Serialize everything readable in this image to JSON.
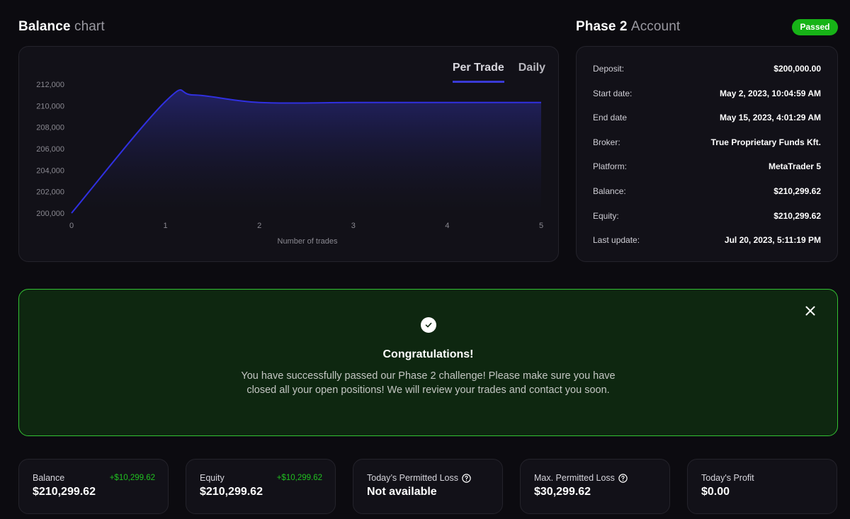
{
  "balance_chart": {
    "title_bold": "Balance",
    "title_muted": "chart",
    "tabs": [
      {
        "label": "Per Trade",
        "active": true
      },
      {
        "label": "Daily",
        "active": false
      }
    ]
  },
  "chart_data": {
    "type": "area",
    "xlabel": "Number of trades",
    "ylabel": "",
    "x_ticks": [
      "0",
      "1",
      "2",
      "3",
      "4",
      "5"
    ],
    "y_ticks": [
      "212,000",
      "210,000",
      "208,000",
      "206,000",
      "204,000",
      "202,000",
      "200,000"
    ],
    "xlim": [
      0,
      5
    ],
    "ylim": [
      200000,
      212000
    ],
    "x": [
      0,
      1,
      1.3,
      2,
      3,
      4,
      5
    ],
    "values": [
      200000,
      210400,
      211000,
      210300,
      210299.62,
      210299.62,
      210299.62
    ],
    "line_color": "#3030e0"
  },
  "account": {
    "title_bold": "Phase 2",
    "title_muted": "Account",
    "status": "Passed",
    "rows": [
      {
        "label": "Deposit:",
        "value": "$200,000.00"
      },
      {
        "label": "Start date:",
        "value": "May 2, 2023, 10:04:59 AM"
      },
      {
        "label": "End date",
        "value": "May 15, 2023, 4:01:29 AM"
      },
      {
        "label": "Broker:",
        "value": "True Proprietary Funds Kft."
      },
      {
        "label": "Platform:",
        "value": "MetaTrader 5"
      },
      {
        "label": "Balance:",
        "value": "$210,299.62"
      },
      {
        "label": "Equity:",
        "value": "$210,299.62"
      },
      {
        "label": "Last update:",
        "value": "Jul 20, 2023, 5:11:19 PM"
      }
    ]
  },
  "banner": {
    "title": "Congratulations!",
    "message": "You have successfully passed our Phase 2 challenge! Please make sure you have closed all your open positions! We will review your trades and contact you soon."
  },
  "stats": [
    {
      "label": "Balance",
      "value": "$210,299.62",
      "delta": "+$10,299.62",
      "help": false
    },
    {
      "label": "Equity",
      "value": "$210,299.62",
      "delta": "+$10,299.62",
      "help": false
    },
    {
      "label": "Today’s Permitted Loss",
      "value": "Not available",
      "delta": "",
      "help": true
    },
    {
      "label": "Max. Permitted Loss",
      "value": "$30,299.62",
      "delta": "",
      "help": true
    },
    {
      "label": "Today's Profit",
      "value": "$0.00",
      "delta": "",
      "help": false
    }
  ],
  "colors": {
    "accent": "#3a3ad6",
    "success": "#17b317",
    "positive": "#20c020",
    "banner_border": "#33c233"
  }
}
